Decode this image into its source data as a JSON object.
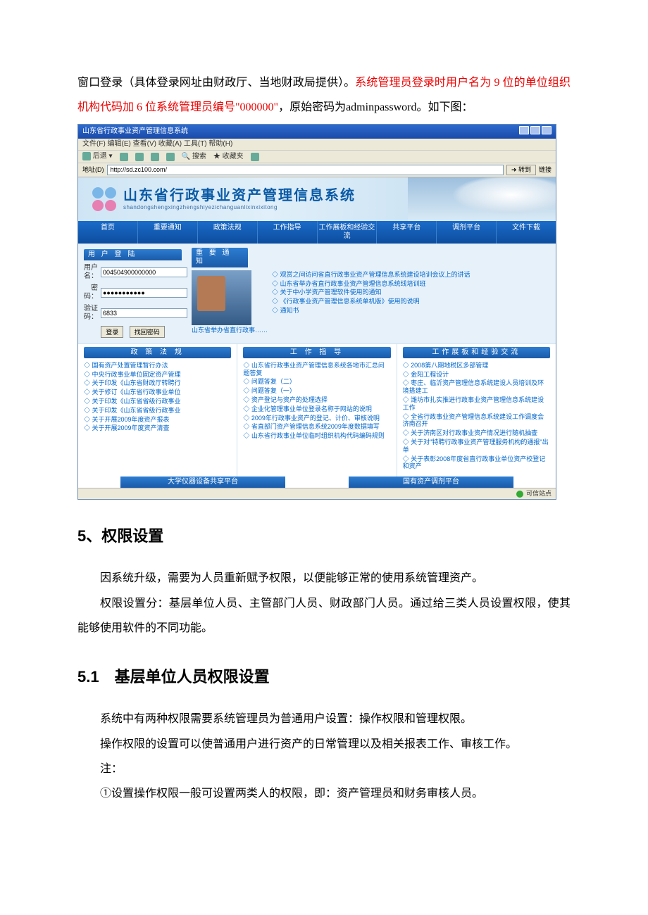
{
  "para1_a": "窗口登录（具体登录网址由财政厅、当地财政局提供）。",
  "para1_b": "系统管理员登录时用户名为 9 位的单位组织机构代码加 6 位系统管理员编号\"000000\"",
  "para1_c": "，原始密码为adminpassword。如下图：",
  "shot": {
    "title": "山东省行政事业资产管理信息系统",
    "menubar": "文件(F)  编辑(E)  查看(V)  收藏(A)  工具(T)  帮助(H)",
    "toolbar": {
      "back": "后退",
      "forward": "",
      "search": "搜索",
      "fav": "收藏夹"
    },
    "addr_label": "地址(D)",
    "addr_url": "http://sd.zc100.com/",
    "go": "转到",
    "links": "链接",
    "banner_title": "山东省行政事业资产管理信息系统",
    "banner_sub": "shandongshengxingzhengshiyezichanguanlixinxixitong",
    "nav": [
      "首页",
      "重要通知",
      "政策法规",
      "工作指导",
      "工作展板和经验交流",
      "共享平台",
      "调剂平台",
      "文件下载"
    ],
    "login_panel": "用 户 登 陆",
    "notice_panel": "重 要 通 知",
    "user_label": "用户名：",
    "user_value": "004504900000000",
    "pwd_label": "密 码：",
    "pwd_value": "●●●●●●●●●●●",
    "cap_label": "验证码：",
    "cap_input": "6833",
    "cap_img": "6833",
    "btn_login": "登录",
    "btn_forgot": "找回密码",
    "notice_caption": "山东省举办省直行政事……",
    "notices": [
      "观赏之间访问省直行政事业资产管理信息系统建设培训会议上的讲话",
      "山东省举办省直行政事业资产管理信息系统线培训班",
      "关于中小学资产管理软件使用的通知",
      "《行政事业资产管理信息系统单机版》使用的说明",
      "通知书"
    ],
    "col1_title": "政 策 法 规",
    "col1": [
      "国有资产处置管理暂行办法",
      "中央行政事业单位固定资产管理",
      "关于印发《山东省财政厅转聘行",
      "关于修订《山东省行政事业单位",
      "关于印发《山东省省级行政事业",
      "关于印发《山东省省级行政事业",
      "关于开展2009年度资产报表",
      "关于开展2009年度资产清查"
    ],
    "col2_title": "工 作 指 导",
    "col2": [
      "山东省行政事业资产管理信息系统各地市汇总问题答复",
      "问题答复（二）",
      "问题答复（一）",
      "资产登记与资产的处理选择",
      "企业化管理事业单位登录名称于网站的说明",
      "2009年行政事业资产的登记、计价、审核说明",
      "省直部门资产管理信息系统2009年度数据填写",
      "山东省行政事业单位临时组织机构代码编码规则"
    ],
    "col3_title": "工作展板和经验交流",
    "col3": [
      "2008第八期地税区多部管理",
      "金阳工程设计",
      "枣庄、临沂资产管理信息系统建设人员培训及环境搭建工",
      "潍坊市扎实推进行政事业资产管理信息系统建设工作",
      "全省行政事业资产管理信息系统建设工作调度会济南召开",
      "关于济南区对行政事业资产情况进行随机抽查",
      "关于对\"特聘行政事业资产管理服务机构的通报\"出单",
      "关于表彰2008年度省直行政事业单位资产校登记和资产"
    ],
    "footer_left": "大学仪器设备共享平台",
    "footer_right": "国有资产调剂平台",
    "status": "可信站点"
  },
  "h5": "5、权限设置",
  "p5a": "因系统升级，需要为人员重新赋予权限，以便能够正常的使用系统管理资产。",
  "p5b": "权限设置分：基层单位人员、主管部门人员、财政部门人员。通过给三类人员设置权限，使其能够使用软件的不同功能。",
  "h51": "5.1　基层单位人员权限设置",
  "p51a": "系统中有两种权限需要系统管理员为普通用户设置：操作权限和管理权限。",
  "p51b": "操作权限的设置可以使普通用户进行资产的日常管理以及相关报表工作、审核工作。",
  "p51c": "注：",
  "p51d": "①设置操作权限一般可设置两类人的权限，即：资产管理员和财务审核人员。"
}
